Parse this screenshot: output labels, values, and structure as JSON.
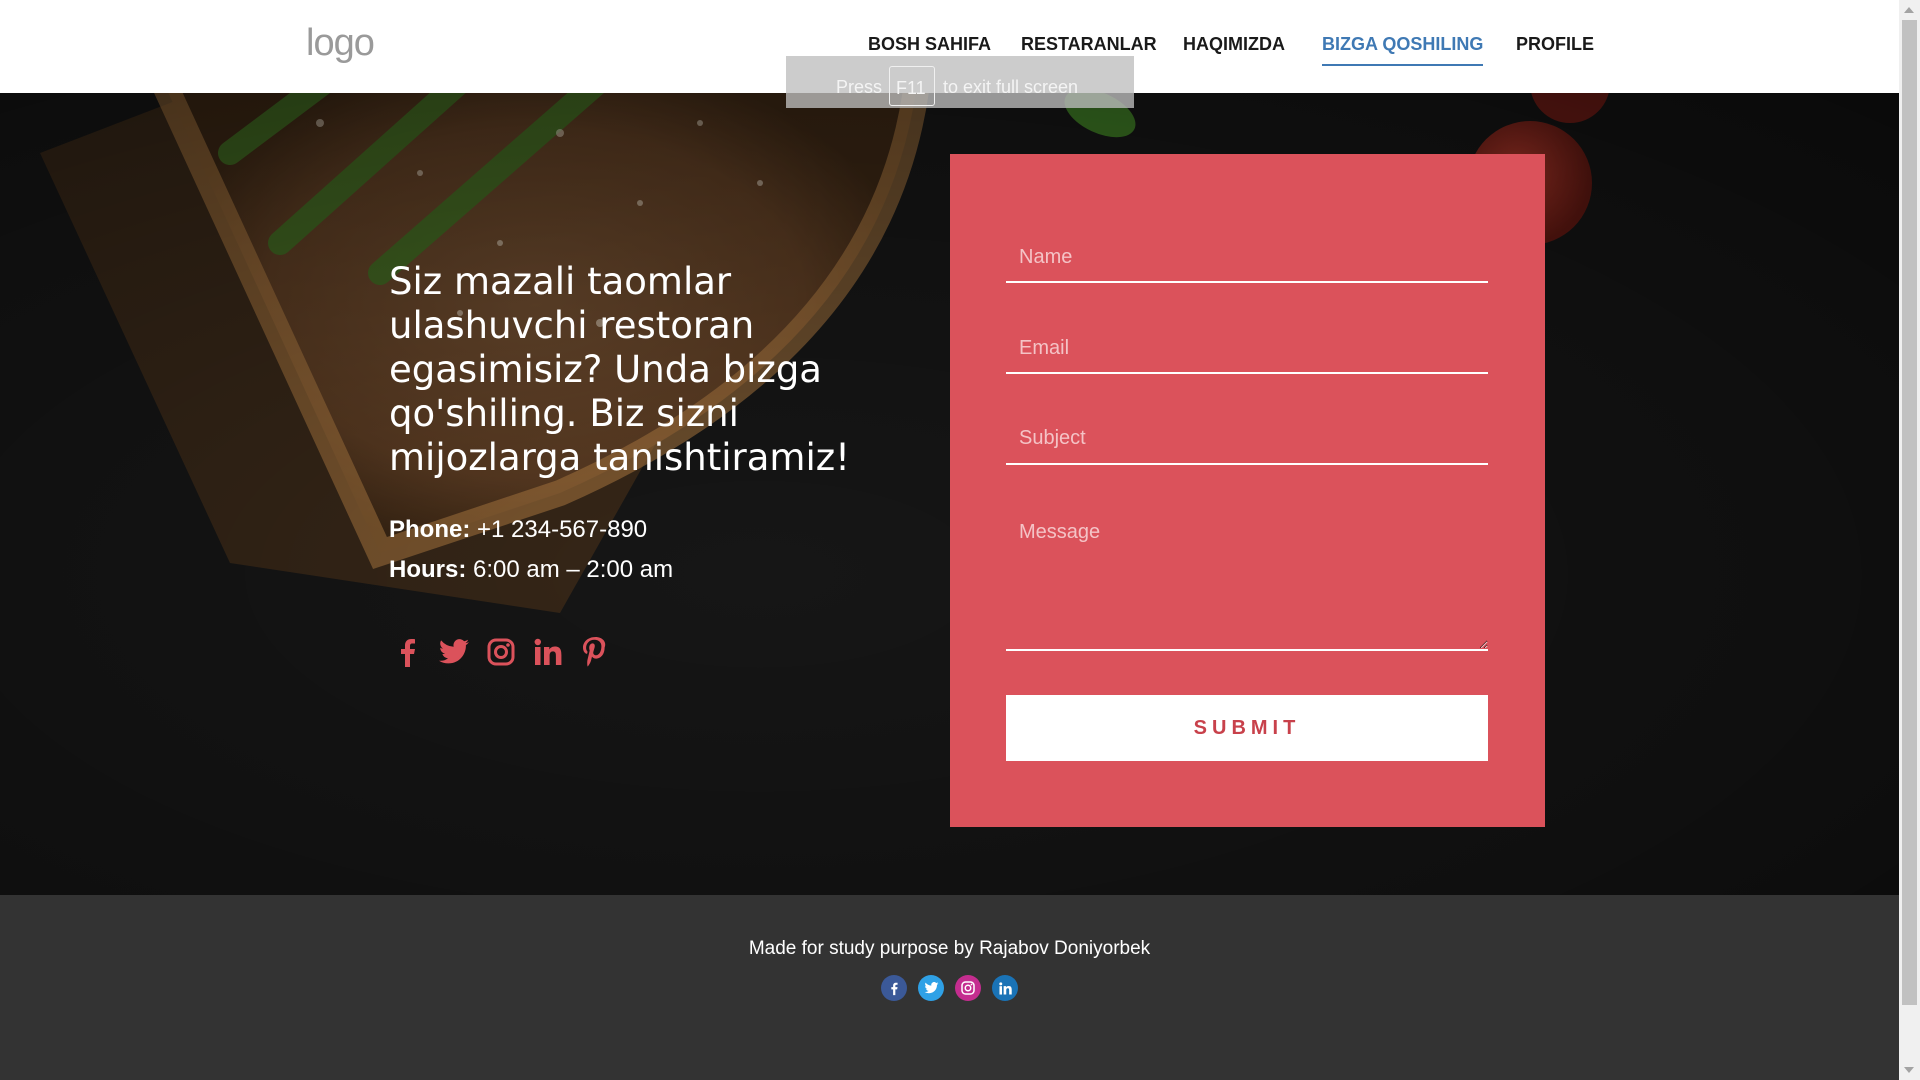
{
  "header": {
    "logo": "logo",
    "nav": [
      {
        "label": "BOSH SAHIFA",
        "active": false
      },
      {
        "label": "RESTARANLAR",
        "active": false
      },
      {
        "label": "HAQIMIZDA",
        "active": false
      },
      {
        "label": "BIZGA QOSHILING",
        "active": true
      },
      {
        "label": "PROFILE",
        "active": false
      }
    ]
  },
  "fullscreen_notice": {
    "before": "Press",
    "key": "F11",
    "after": "to exit full screen"
  },
  "hero": {
    "headline": "Siz mazali taomlar ulashuvchi restoran egasimisiz? Unda bizga qo'shiling. Biz sizni mijozlarga tanishtiramiz!",
    "phone_label": "Phone:",
    "phone_value": "+1 234-567-890",
    "hours_label": "Hours:",
    "hours_value": "6:00 am – 2:00 am",
    "social_icons": [
      "facebook-icon",
      "twitter-icon",
      "instagram-icon",
      "linkedin-icon",
      "pinterest-icon"
    ],
    "accent_color": "#db525b"
  },
  "form": {
    "name_placeholder": "Name",
    "email_placeholder": "Email",
    "subject_placeholder": "Subject",
    "message_placeholder": "Message",
    "submit_label": "SUBMIT",
    "card_color": "#db525b"
  },
  "footer": {
    "text": "Made for study purpose by Rajabov Doniyorbek",
    "social_icons": [
      "facebook-icon",
      "twitter-icon",
      "instagram-icon",
      "linkedin-icon"
    ]
  }
}
